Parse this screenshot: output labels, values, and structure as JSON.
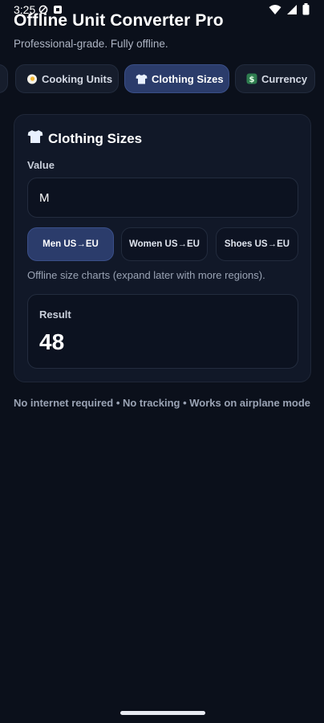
{
  "status_bar": {
    "time": "3:25"
  },
  "header": {
    "title": "Offline Unit Converter Pro",
    "subtitle": "Professional-grade. Fully offline."
  },
  "tabs": [
    {
      "icon": "egg-icon",
      "label": "Cooking Units",
      "active": false
    },
    {
      "icon": "tshirt-icon",
      "label": "Clothing Sizes",
      "active": true
    },
    {
      "icon": "dollar-icon",
      "label": "Currency",
      "active": false
    }
  ],
  "card": {
    "title": "Clothing Sizes",
    "icon": "tshirt-icon",
    "value_label": "Value",
    "value": "M",
    "chips": [
      {
        "label": "Men US→EU",
        "active": true
      },
      {
        "label": "Women US→EU",
        "active": false
      },
      {
        "label": "Shoes US→EU",
        "active": false
      }
    ],
    "hint": "Offline size charts (expand later with more regions).",
    "result_label": "Result",
    "result_value": "48"
  },
  "footer": {
    "note": "No internet required • No tracking • Works on airplane mode"
  },
  "colors": {
    "background": "#0b101b",
    "card": "#111828",
    "accent": "#2b3c6b",
    "accent_border": "#3a4f88"
  }
}
